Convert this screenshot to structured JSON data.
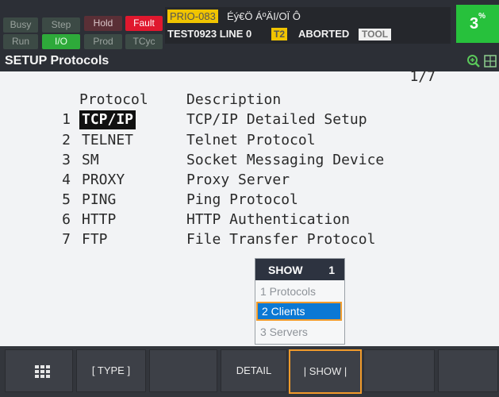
{
  "status": {
    "indicators": [
      {
        "label": "Busy",
        "state": "off"
      },
      {
        "label": "Step",
        "state": "off"
      },
      {
        "label": "Hold",
        "state": "off"
      },
      {
        "label": "Fault",
        "state": "on"
      },
      {
        "label": "Run",
        "state": "off"
      },
      {
        "label": "I/O",
        "state": "on"
      },
      {
        "label": "Prod",
        "state": "off"
      },
      {
        "label": "TCyc",
        "state": "off"
      }
    ],
    "alarm_code": "PRIO-083",
    "alarm_text": "Éý€Ö ÁºÄI/OÏ  Ô",
    "program_line": "TEST0923 LINE 0",
    "task_badge": "T2",
    "program_state": "ABORTED",
    "frame_badge": "TOOL",
    "override": "3",
    "override_suffix": "%"
  },
  "title": "SETUP Protocols",
  "page_indicator": "1/7",
  "columns": {
    "protocol": "Protocol",
    "description": "Description"
  },
  "rows": [
    {
      "num": "1",
      "protocol": "TCP/IP",
      "description": "TCP/IP Detailed Setup",
      "selected": true
    },
    {
      "num": "2",
      "protocol": "TELNET",
      "description": "Telnet Protocol",
      "selected": false
    },
    {
      "num": "3",
      "protocol": "SM",
      "description": "Socket Messaging Device",
      "selected": false
    },
    {
      "num": "4",
      "protocol": "PROXY",
      "description": "Proxy Server",
      "selected": false
    },
    {
      "num": "5",
      "protocol": "PING",
      "description": "Ping Protocol",
      "selected": false
    },
    {
      "num": "6",
      "protocol": "HTTP",
      "description": "HTTP Authentication",
      "selected": false
    },
    {
      "num": "7",
      "protocol": "FTP",
      "description": "File Transfer Protocol",
      "selected": false
    }
  ],
  "popup": {
    "title": "SHOW",
    "number": "1",
    "items": [
      "1 Protocols",
      "2 Clients",
      "3 Servers"
    ],
    "selected_index": 1
  },
  "function_keys": [
    {
      "label": "",
      "icon": "grid-icon"
    },
    {
      "label": "[ TYPE ]"
    },
    {
      "label": ""
    },
    {
      "label": "DETAIL"
    },
    {
      "label": "| SHOW |",
      "highlighted": true
    },
    {
      "label": ""
    }
  ],
  "colors": {
    "fault": "#e0182e",
    "io_active": "#2eaa3a",
    "override_bg": "#27c13c",
    "alarm_badge": "#f0c400",
    "highlight_border": "#f29b2b",
    "selection_blue": "#0b78d4"
  }
}
